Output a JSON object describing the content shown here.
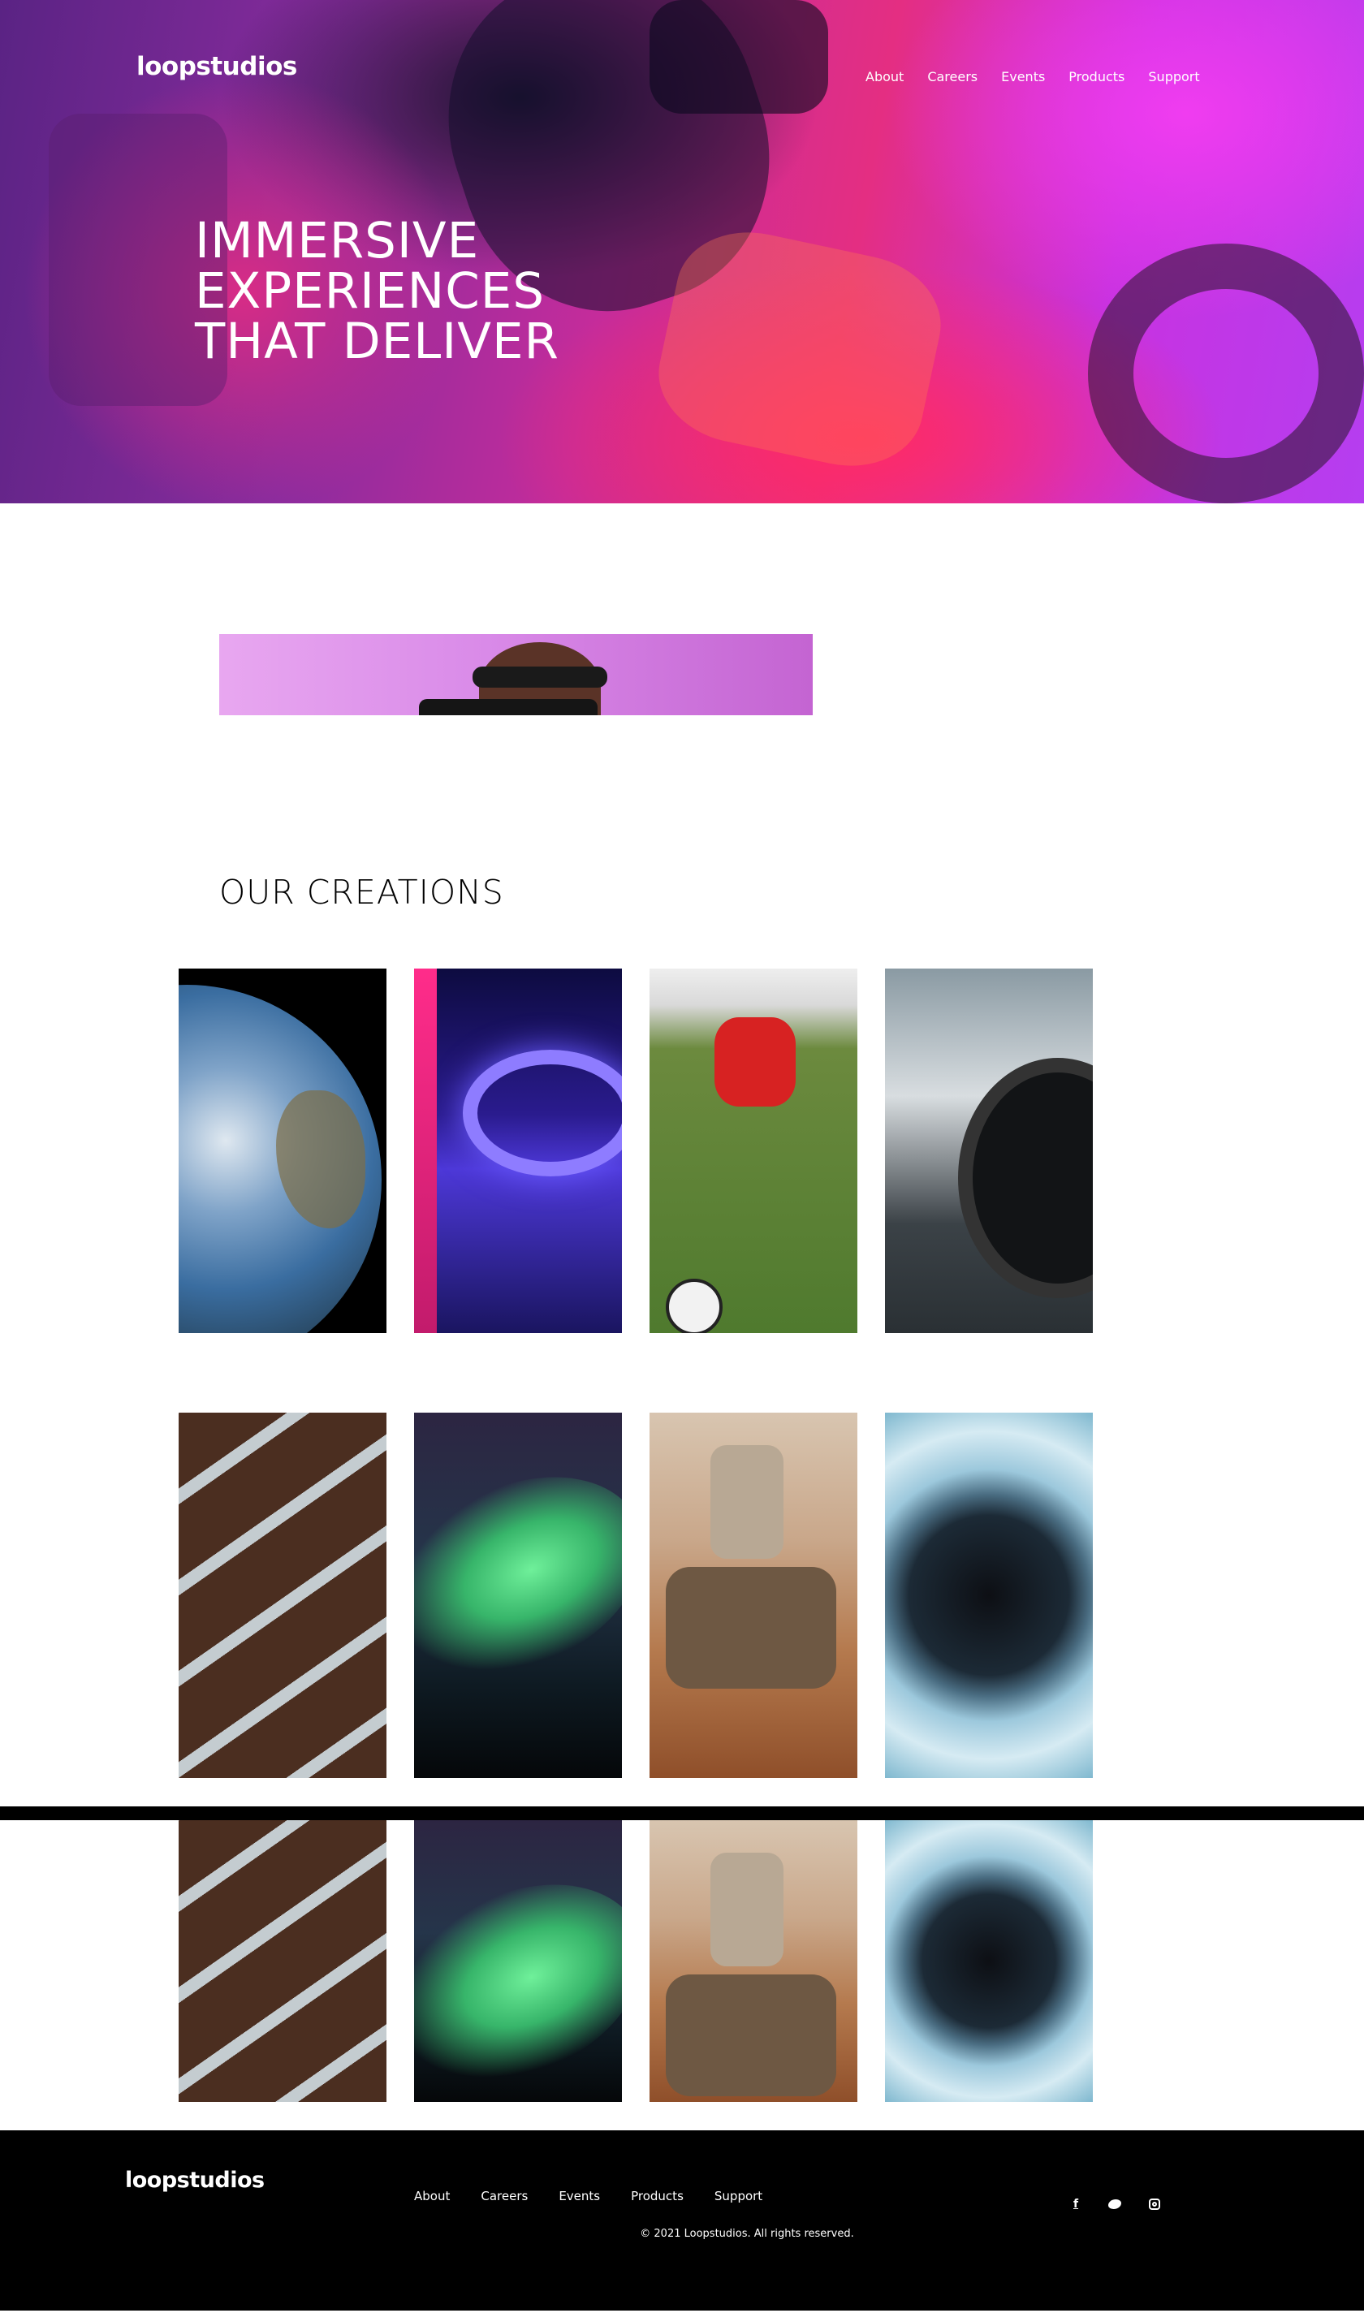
{
  "brand": {
    "name": "loopstudios"
  },
  "nav": {
    "items": [
      "About",
      "Careers",
      "Events",
      "Products",
      "Support"
    ]
  },
  "hero": {
    "title_lines": [
      "IMMERSIVE",
      "EXPERIENCES",
      "THAT DELIVER"
    ]
  },
  "creations": {
    "title": "OUR CREATIONS",
    "row1": [
      "earth",
      "arcade",
      "soccer",
      "car"
    ],
    "row2": [
      "roads",
      "aurora",
      "mars-rover",
      "planet"
    ],
    "row3": [
      "roads",
      "aurora",
      "mars-rover",
      "planet"
    ]
  },
  "footer": {
    "brand": "loopstudios",
    "nav": [
      "About",
      "Careers",
      "Events",
      "Products",
      "Support"
    ],
    "copyright": "© 2021 Loopstudios. All rights reserved.",
    "social": [
      "facebook-icon",
      "twitter-icon",
      "instagram-icon"
    ],
    "social_glyphs": {
      "facebook": "f"
    }
  }
}
